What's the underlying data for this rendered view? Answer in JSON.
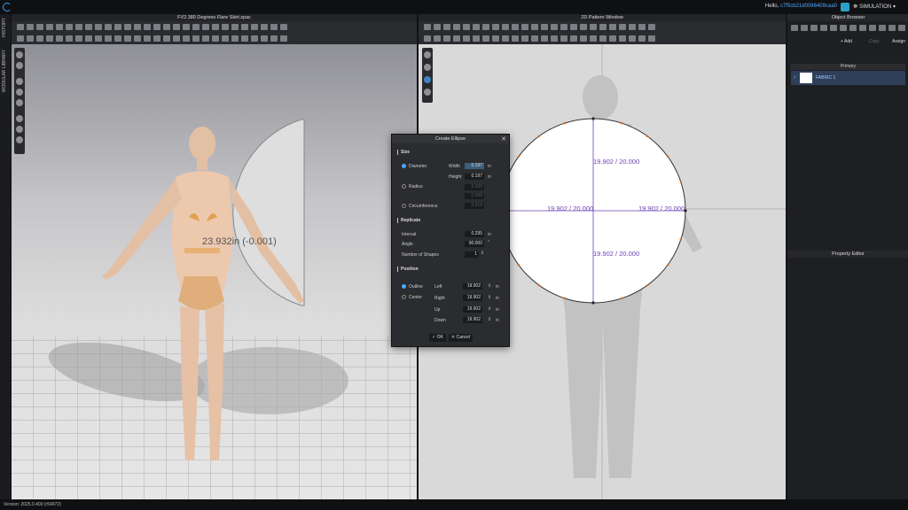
{
  "header": {
    "greeting": "Hello,",
    "user_id": "c7f5cb21d0086409caa0",
    "mode": "SIMULATION"
  },
  "left_tabs": [
    "HISTORY",
    "MODULAR LIBRARY"
  ],
  "viewport_3d": {
    "title": "FV2.380 Degrees Flare Skirt.zpac",
    "measurement": "23.932in (-0.001)"
  },
  "viewport_2d": {
    "title": "2D Pattern Window",
    "measurements": {
      "top": "19.902 / 20.000",
      "left": "19.902 / 20.000",
      "right": "19.902 / 20.000",
      "bottom": "19.902 / 20.000"
    }
  },
  "object_browser": {
    "title": "Object Browser",
    "add_label": "+ Add",
    "copy_label": "Copy",
    "assign_label": "Assign",
    "group_label": "Primary",
    "fabric_name": "FABRIC 1"
  },
  "property_editor": {
    "title": "Property Editor"
  },
  "dialog": {
    "title": "Create Ellipse",
    "size_section": "Size",
    "diameter_label": "Diameter",
    "radius_label": "Radius",
    "circumference_label": "Circumference",
    "width_label": "Width",
    "height_label": "Height",
    "width_value": "0.197",
    "height_value": "0.197",
    "radius_width_value": "0.098",
    "radius_height_value": "0.098",
    "circumference_value": "0.618",
    "unit_in": "in",
    "replicate_section": "Replicate",
    "interval_label": "Interval",
    "interval_value": "0.295",
    "angle_label": "Angle",
    "angle_value": "90.000",
    "angle_unit": "°",
    "shapes_label": "Number of Shapes",
    "shapes_value": "1",
    "position_section": "Position",
    "outline_label": "Outline",
    "center_label": "Center",
    "left_label": "Left",
    "right_label": "Right",
    "up_label": "Up",
    "down_label": "Down",
    "left_value": "19.902",
    "right_value": "19.902",
    "up_value": "19.902",
    "down_value": "19.902",
    "ok_label": "OK",
    "cancel_label": "Cancel"
  },
  "status": {
    "version": "Version: 2025.0.400 (r54972)"
  },
  "colors": {
    "accent": "#4aa8ff",
    "measure": "#6b3fb2",
    "point": "#e07020"
  }
}
